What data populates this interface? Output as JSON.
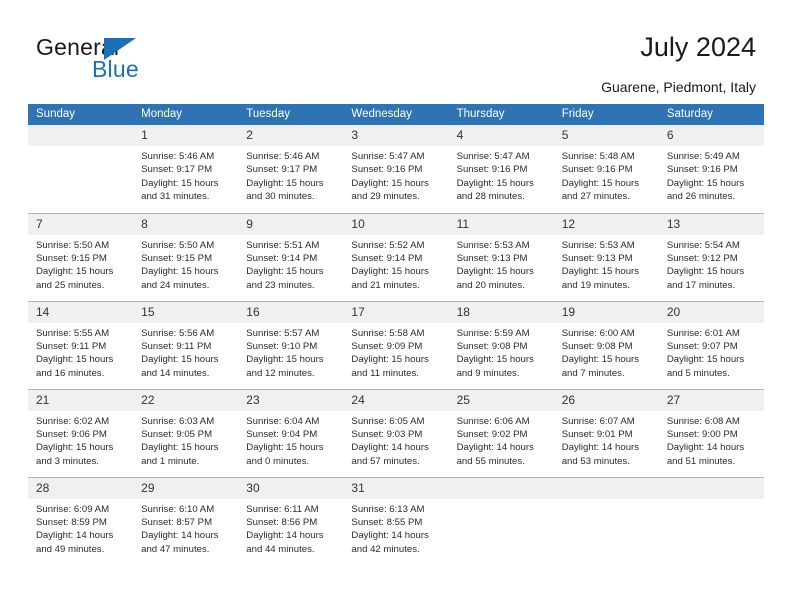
{
  "brand": {
    "name_part1": "General",
    "name_part2": "Blue",
    "accent_color": "#1d70b7",
    "triangle_icon": "brand-triangle-icon"
  },
  "header": {
    "title": "July 2024",
    "subtitle": "Guarene, Piedmont, Italy"
  },
  "calendar": {
    "header_bg": "#2e74b5",
    "daynum_bg": "#f0f0f0",
    "grid_line": "#9fb9d4",
    "weekday_headers": [
      "Sunday",
      "Monday",
      "Tuesday",
      "Wednesday",
      "Thursday",
      "Friday",
      "Saturday"
    ],
    "labels": {
      "sunrise": "Sunrise:",
      "sunset": "Sunset:",
      "daylight": "Daylight:"
    },
    "weeks": [
      [
        {
          "day": "",
          "empty": true
        },
        {
          "day": "1",
          "sunrise": "Sunrise: 5:46 AM",
          "sunset": "Sunset: 9:17 PM",
          "daylight_line1": "Daylight: 15 hours",
          "daylight_line2": "and 31 minutes."
        },
        {
          "day": "2",
          "sunrise": "Sunrise: 5:46 AM",
          "sunset": "Sunset: 9:17 PM",
          "daylight_line1": "Daylight: 15 hours",
          "daylight_line2": "and 30 minutes."
        },
        {
          "day": "3",
          "sunrise": "Sunrise: 5:47 AM",
          "sunset": "Sunset: 9:16 PM",
          "daylight_line1": "Daylight: 15 hours",
          "daylight_line2": "and 29 minutes."
        },
        {
          "day": "4",
          "sunrise": "Sunrise: 5:47 AM",
          "sunset": "Sunset: 9:16 PM",
          "daylight_line1": "Daylight: 15 hours",
          "daylight_line2": "and 28 minutes."
        },
        {
          "day": "5",
          "sunrise": "Sunrise: 5:48 AM",
          "sunset": "Sunset: 9:16 PM",
          "daylight_line1": "Daylight: 15 hours",
          "daylight_line2": "and 27 minutes."
        },
        {
          "day": "6",
          "sunrise": "Sunrise: 5:49 AM",
          "sunset": "Sunset: 9:16 PM",
          "daylight_line1": "Daylight: 15 hours",
          "daylight_line2": "and 26 minutes."
        }
      ],
      [
        {
          "day": "7",
          "sunrise": "Sunrise: 5:50 AM",
          "sunset": "Sunset: 9:15 PM",
          "daylight_line1": "Daylight: 15 hours",
          "daylight_line2": "and 25 minutes."
        },
        {
          "day": "8",
          "sunrise": "Sunrise: 5:50 AM",
          "sunset": "Sunset: 9:15 PM",
          "daylight_line1": "Daylight: 15 hours",
          "daylight_line2": "and 24 minutes."
        },
        {
          "day": "9",
          "sunrise": "Sunrise: 5:51 AM",
          "sunset": "Sunset: 9:14 PM",
          "daylight_line1": "Daylight: 15 hours",
          "daylight_line2": "and 23 minutes."
        },
        {
          "day": "10",
          "sunrise": "Sunrise: 5:52 AM",
          "sunset": "Sunset: 9:14 PM",
          "daylight_line1": "Daylight: 15 hours",
          "daylight_line2": "and 21 minutes."
        },
        {
          "day": "11",
          "sunrise": "Sunrise: 5:53 AM",
          "sunset": "Sunset: 9:13 PM",
          "daylight_line1": "Daylight: 15 hours",
          "daylight_line2": "and 20 minutes."
        },
        {
          "day": "12",
          "sunrise": "Sunrise: 5:53 AM",
          "sunset": "Sunset: 9:13 PM",
          "daylight_line1": "Daylight: 15 hours",
          "daylight_line2": "and 19 minutes."
        },
        {
          "day": "13",
          "sunrise": "Sunrise: 5:54 AM",
          "sunset": "Sunset: 9:12 PM",
          "daylight_line1": "Daylight: 15 hours",
          "daylight_line2": "and 17 minutes."
        }
      ],
      [
        {
          "day": "14",
          "sunrise": "Sunrise: 5:55 AM",
          "sunset": "Sunset: 9:11 PM",
          "daylight_line1": "Daylight: 15 hours",
          "daylight_line2": "and 16 minutes."
        },
        {
          "day": "15",
          "sunrise": "Sunrise: 5:56 AM",
          "sunset": "Sunset: 9:11 PM",
          "daylight_line1": "Daylight: 15 hours",
          "daylight_line2": "and 14 minutes."
        },
        {
          "day": "16",
          "sunrise": "Sunrise: 5:57 AM",
          "sunset": "Sunset: 9:10 PM",
          "daylight_line1": "Daylight: 15 hours",
          "daylight_line2": "and 12 minutes."
        },
        {
          "day": "17",
          "sunrise": "Sunrise: 5:58 AM",
          "sunset": "Sunset: 9:09 PM",
          "daylight_line1": "Daylight: 15 hours",
          "daylight_line2": "and 11 minutes."
        },
        {
          "day": "18",
          "sunrise": "Sunrise: 5:59 AM",
          "sunset": "Sunset: 9:08 PM",
          "daylight_line1": "Daylight: 15 hours",
          "daylight_line2": "and 9 minutes."
        },
        {
          "day": "19",
          "sunrise": "Sunrise: 6:00 AM",
          "sunset": "Sunset: 9:08 PM",
          "daylight_line1": "Daylight: 15 hours",
          "daylight_line2": "and 7 minutes."
        },
        {
          "day": "20",
          "sunrise": "Sunrise: 6:01 AM",
          "sunset": "Sunset: 9:07 PM",
          "daylight_line1": "Daylight: 15 hours",
          "daylight_line2": "and 5 minutes."
        }
      ],
      [
        {
          "day": "21",
          "sunrise": "Sunrise: 6:02 AM",
          "sunset": "Sunset: 9:06 PM",
          "daylight_line1": "Daylight: 15 hours",
          "daylight_line2": "and 3 minutes."
        },
        {
          "day": "22",
          "sunrise": "Sunrise: 6:03 AM",
          "sunset": "Sunset: 9:05 PM",
          "daylight_line1": "Daylight: 15 hours",
          "daylight_line2": "and 1 minute."
        },
        {
          "day": "23",
          "sunrise": "Sunrise: 6:04 AM",
          "sunset": "Sunset: 9:04 PM",
          "daylight_line1": "Daylight: 15 hours",
          "daylight_line2": "and 0 minutes."
        },
        {
          "day": "24",
          "sunrise": "Sunrise: 6:05 AM",
          "sunset": "Sunset: 9:03 PM",
          "daylight_line1": "Daylight: 14 hours",
          "daylight_line2": "and 57 minutes."
        },
        {
          "day": "25",
          "sunrise": "Sunrise: 6:06 AM",
          "sunset": "Sunset: 9:02 PM",
          "daylight_line1": "Daylight: 14 hours",
          "daylight_line2": "and 55 minutes."
        },
        {
          "day": "26",
          "sunrise": "Sunrise: 6:07 AM",
          "sunset": "Sunset: 9:01 PM",
          "daylight_line1": "Daylight: 14 hours",
          "daylight_line2": "and 53 minutes."
        },
        {
          "day": "27",
          "sunrise": "Sunrise: 6:08 AM",
          "sunset": "Sunset: 9:00 PM",
          "daylight_line1": "Daylight: 14 hours",
          "daylight_line2": "and 51 minutes."
        }
      ],
      [
        {
          "day": "28",
          "sunrise": "Sunrise: 6:09 AM",
          "sunset": "Sunset: 8:59 PM",
          "daylight_line1": "Daylight: 14 hours",
          "daylight_line2": "and 49 minutes."
        },
        {
          "day": "29",
          "sunrise": "Sunrise: 6:10 AM",
          "sunset": "Sunset: 8:57 PM",
          "daylight_line1": "Daylight: 14 hours",
          "daylight_line2": "and 47 minutes."
        },
        {
          "day": "30",
          "sunrise": "Sunrise: 6:11 AM",
          "sunset": "Sunset: 8:56 PM",
          "daylight_line1": "Daylight: 14 hours",
          "daylight_line2": "and 44 minutes."
        },
        {
          "day": "31",
          "sunrise": "Sunrise: 6:13 AM",
          "sunset": "Sunset: 8:55 PM",
          "daylight_line1": "Daylight: 14 hours",
          "daylight_line2": "and 42 minutes."
        },
        {
          "day": "",
          "empty": true
        },
        {
          "day": "",
          "empty": true
        },
        {
          "day": "",
          "empty": true
        }
      ]
    ]
  }
}
